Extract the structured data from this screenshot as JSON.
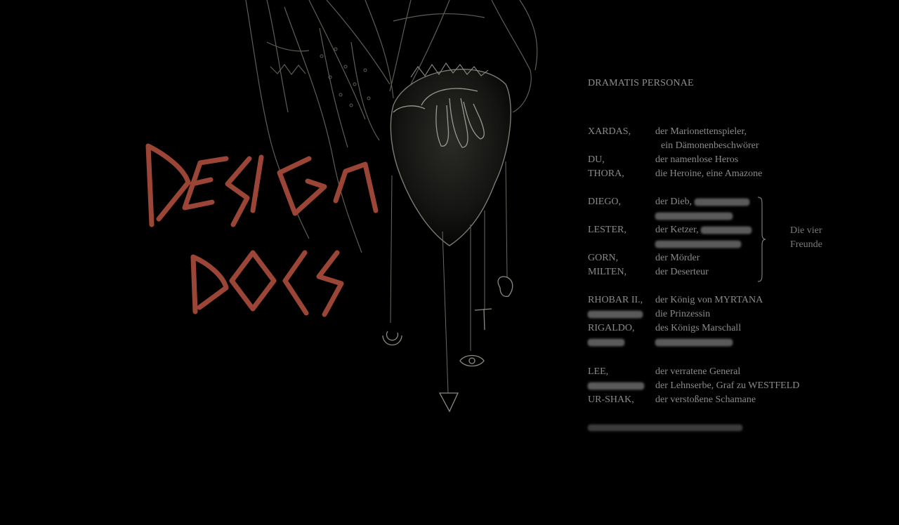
{
  "logo": {
    "lettering": "DESIGN DOCS",
    "color": "#9b4537"
  },
  "cast": {
    "heading": "DRAMATIS PERSONAE",
    "entries": [
      {
        "name": "XARDAS,",
        "role": "der Marionettenspieler,"
      },
      {
        "name": "",
        "role": "ein Dämonenbeschwörer"
      },
      {
        "name": "DU,",
        "role": "der namenlose Heros"
      },
      {
        "name": "THORA,",
        "role": "die Heroine, eine Amazone"
      },
      {
        "name": "DIEGO,",
        "role": "der Dieb,"
      },
      {
        "name": "LESTER,",
        "role": "der Ketzer,"
      },
      {
        "name": "GORN,",
        "role": "der Mörder"
      },
      {
        "name": "MILTEN,",
        "role": "der Deserteur"
      },
      {
        "name": "RHOBAR II.,",
        "role": "der König von MYRTANA"
      },
      {
        "name": "",
        "role": "die Prinzessin"
      },
      {
        "name": "RIGALDO,",
        "role": "des Königs Marschall"
      },
      {
        "name": "LEE,",
        "role": "der verratene General"
      },
      {
        "name": "",
        "role": "der Lehnserbe, Graf zu WESTFELD"
      },
      {
        "name": "UR-SHAK,",
        "role": "der verstoßene Schamane"
      }
    ],
    "group_label_line1": "Die vier",
    "group_label_line2": "Freunde"
  }
}
